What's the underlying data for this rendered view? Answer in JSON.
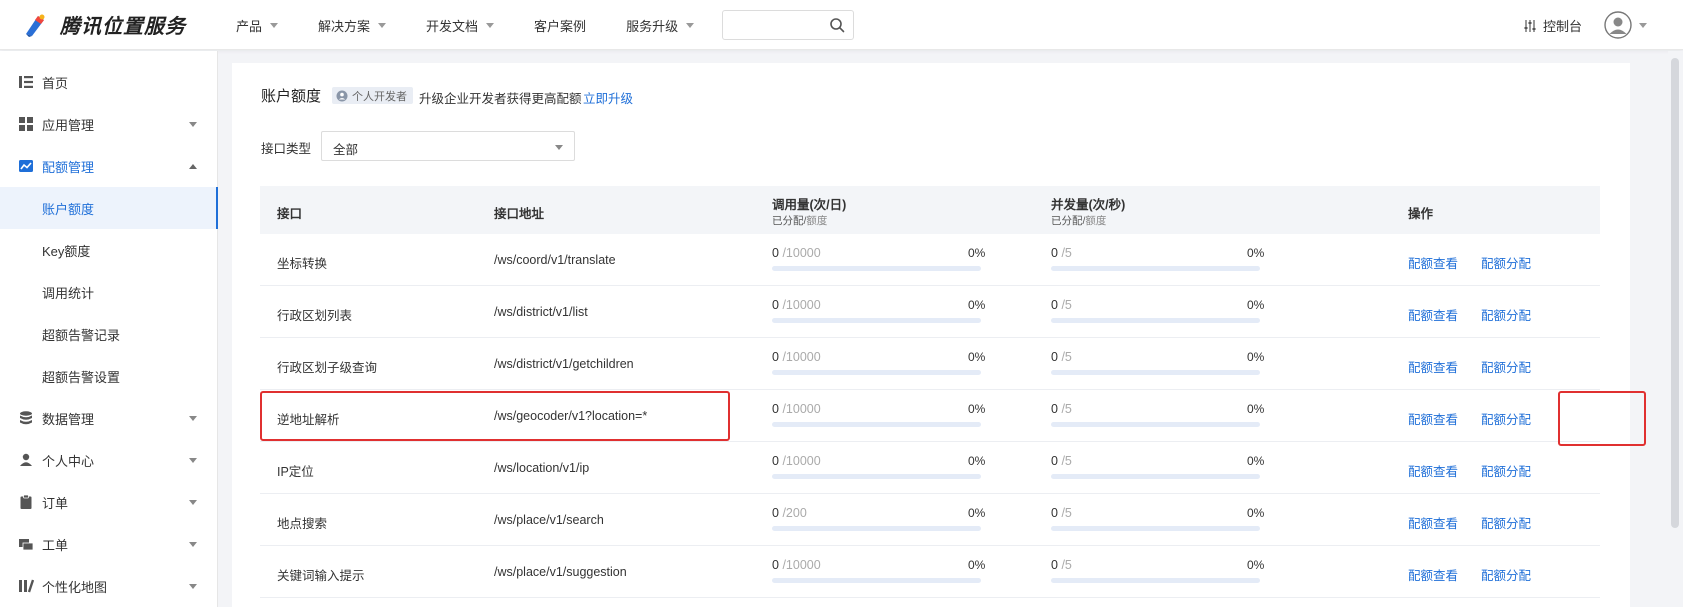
{
  "header": {
    "logo_text": "腾讯位置服务",
    "nav": [
      {
        "label": "产品",
        "has_caret": true
      },
      {
        "label": "解决方案",
        "has_caret": true
      },
      {
        "label": "开发文档",
        "has_caret": true
      },
      {
        "label": "客户案例",
        "has_caret": false
      },
      {
        "label": "服务升级",
        "has_caret": true
      }
    ],
    "search_value": "",
    "console_label": "控制台"
  },
  "sidebar": {
    "items": [
      {
        "label": "首页",
        "icon": "list-icon"
      },
      {
        "label": "应用管理",
        "icon": "grid-icon"
      },
      {
        "label": "配额管理",
        "icon": "chart-icon"
      },
      {
        "label": "数据管理",
        "icon": "database-icon"
      },
      {
        "label": "个人中心",
        "icon": "user-icon"
      },
      {
        "label": "订单",
        "icon": "clipboard-icon"
      },
      {
        "label": "工单",
        "icon": "ticket-icon"
      },
      {
        "label": "个性化地图",
        "icon": "map-style-icon"
      }
    ],
    "subitems": [
      {
        "label": "账户额度"
      },
      {
        "label": "Key额度"
      },
      {
        "label": "调用统计"
      },
      {
        "label": "超额告警记录"
      },
      {
        "label": "超额告警设置"
      }
    ]
  },
  "content": {
    "title": "账户额度",
    "badge": "个人开发者",
    "upgrade_text": "升级企业开发者获得更高配额",
    "upgrade_link": "立即升级",
    "filter_label": "接口类型",
    "filter_value": "全部"
  },
  "table": {
    "headers": {
      "api": "接口",
      "path": "接口地址",
      "calls": "调用量(次/日)",
      "calls_sub_used": "已分配/",
      "calls_sub_total": "额度",
      "concurrency": "并发量(次/秒)",
      "conc_sub_used": "已分配/",
      "conc_sub_total": "额度",
      "actions": "操作"
    },
    "action_view": "配额查看",
    "action_assign": "配额分配",
    "rows": [
      {
        "name": "坐标转换",
        "path": "/ws/coord/v1/translate",
        "calls_used": "0",
        "calls_total": "/10000",
        "calls_pct": "0%",
        "conc_used": "0",
        "conc_total": "/5",
        "conc_pct": "0%"
      },
      {
        "name": "行政区划列表",
        "path": "/ws/district/v1/list",
        "calls_used": "0",
        "calls_total": "/10000",
        "calls_pct": "0%",
        "conc_used": "0",
        "conc_total": "/5",
        "conc_pct": "0%"
      },
      {
        "name": "行政区划子级查询",
        "path": "/ws/district/v1/getchildren",
        "calls_used": "0",
        "calls_total": "/10000",
        "calls_pct": "0%",
        "conc_used": "0",
        "conc_total": "/5",
        "conc_pct": "0%"
      },
      {
        "name": "逆地址解析",
        "path": "/ws/geocoder/v1?location=*",
        "calls_used": "0",
        "calls_total": "/10000",
        "calls_pct": "0%",
        "conc_used": "0",
        "conc_total": "/5",
        "conc_pct": "0%"
      },
      {
        "name": "IP定位",
        "path": "/ws/location/v1/ip",
        "calls_used": "0",
        "calls_total": "/10000",
        "calls_pct": "0%",
        "conc_used": "0",
        "conc_total": "/5",
        "conc_pct": "0%"
      },
      {
        "name": "地点搜索",
        "path": "/ws/place/v1/search",
        "calls_used": "0",
        "calls_total": "/200",
        "calls_pct": "0%",
        "conc_used": "0",
        "conc_total": "/5",
        "conc_pct": "0%"
      },
      {
        "name": "关键词输入提示",
        "path": "/ws/place/v1/suggestion",
        "calls_used": "0",
        "calls_total": "/10000",
        "calls_pct": "0%",
        "conc_used": "0",
        "conc_total": "/5",
        "conc_pct": "0%"
      }
    ]
  },
  "colors": {
    "accent": "#1f6fd8",
    "highlight": "#e03030"
  }
}
